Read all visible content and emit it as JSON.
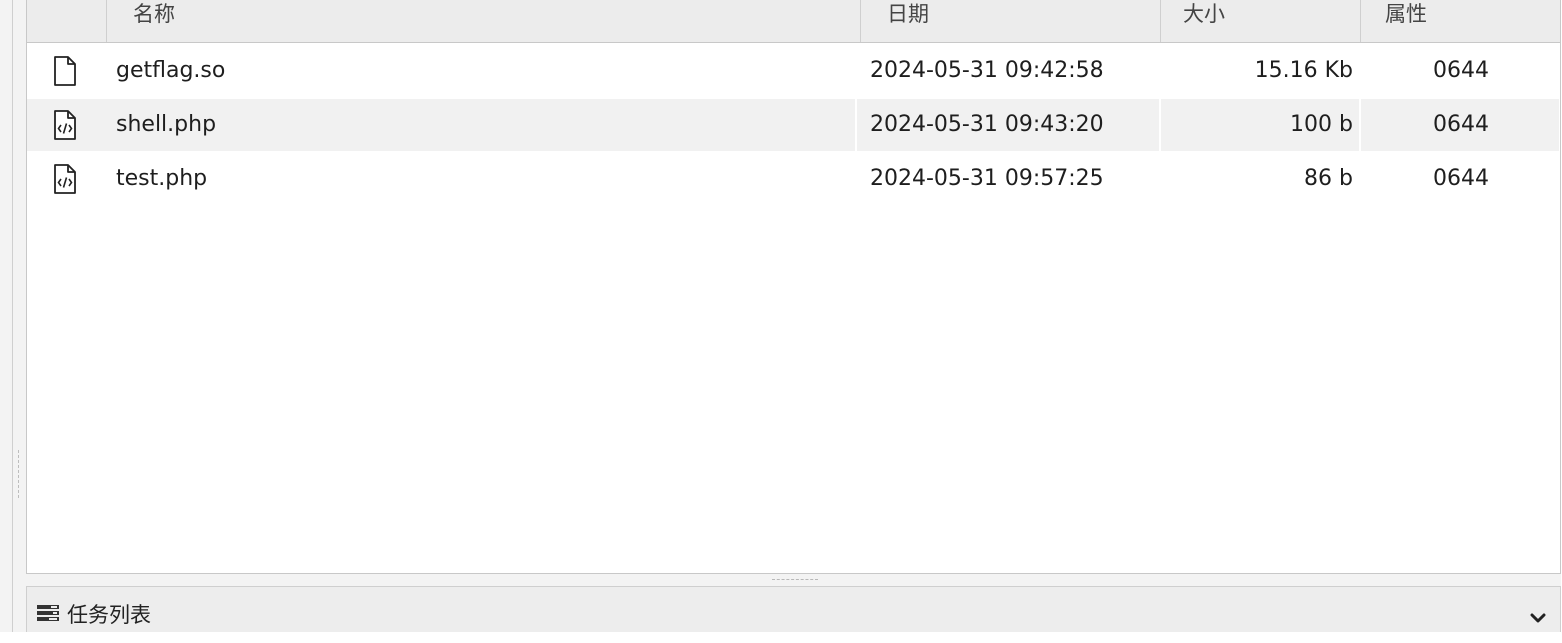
{
  "table": {
    "columns": {
      "name": "名称",
      "date": "日期",
      "size": "大小",
      "attributes": "属性"
    },
    "rows": [
      {
        "icon": "file-icon",
        "name": "getflag.so",
        "date": "2024-05-31 09:42:58",
        "size": "15.16 Kb",
        "attributes": "0644"
      },
      {
        "icon": "code-file-icon",
        "name": "shell.php",
        "date": "2024-05-31 09:43:20",
        "size": "100 b",
        "attributes": "0644"
      },
      {
        "icon": "code-file-icon",
        "name": "test.php",
        "date": "2024-05-31 09:57:25",
        "size": "86 b",
        "attributes": "0644"
      }
    ]
  },
  "tasks_panel": {
    "icon": "task-list-icon",
    "label": "任务列表",
    "toggle_icon": "chevron-down-icon"
  }
}
